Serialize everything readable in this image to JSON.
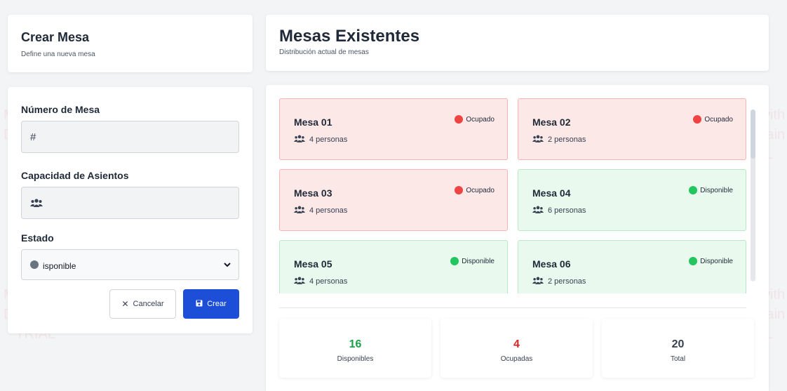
{
  "create_header": {
    "title": "Crear Mesa",
    "subtitle": "Define una nueva mesa"
  },
  "tables_header": {
    "title": "Mesas Existentes",
    "subtitle": "Distribución actual de mesas"
  },
  "form": {
    "number_label": "Número de Mesa",
    "number_icon": "hash-icon",
    "number_glyph": "#",
    "capacity_label": "Capacidad de Asientos",
    "capacity_icon": "users-icon",
    "status_label": "Estado",
    "status_value": "isponible",
    "cancel_label": "Cancelar",
    "create_label": "Crear"
  },
  "tables": [
    {
      "name": "Mesa 01",
      "capacity": "4 personas",
      "status": "Ocupado",
      "status_color": "#ef4444"
    },
    {
      "name": "Mesa 02",
      "capacity": "2 personas",
      "status": "Ocupado",
      "status_color": "#ef4444"
    },
    {
      "name": "Mesa 03",
      "capacity": "4 personas",
      "status": "Ocupado",
      "status_color": "#ef4444"
    },
    {
      "name": "Mesa 04",
      "capacity": "6 personas",
      "status": "Disponible",
      "status_color": "#22c55e"
    },
    {
      "name": "Mesa 05",
      "capacity": "4 personas",
      "status": "Disponible",
      "status_color": "#22c55e"
    },
    {
      "name": "Mesa 06",
      "capacity": "2 personas",
      "status": "Disponible",
      "status_color": "#22c55e"
    }
  ],
  "stats": [
    {
      "value": "16",
      "label": "Disponibles",
      "color": "#16a34a"
    },
    {
      "value": "4",
      "label": "Ocupadas",
      "color": "#dc2626"
    },
    {
      "value": "20",
      "label": "Total",
      "color": "#374151"
    }
  ],
  "watermark": "Made with Dr.Explain TRIAL",
  "colors": {
    "primary": "#1d4ed8",
    "occupied_bg": "#fde8e8",
    "available_bg": "#e9f9ee"
  }
}
